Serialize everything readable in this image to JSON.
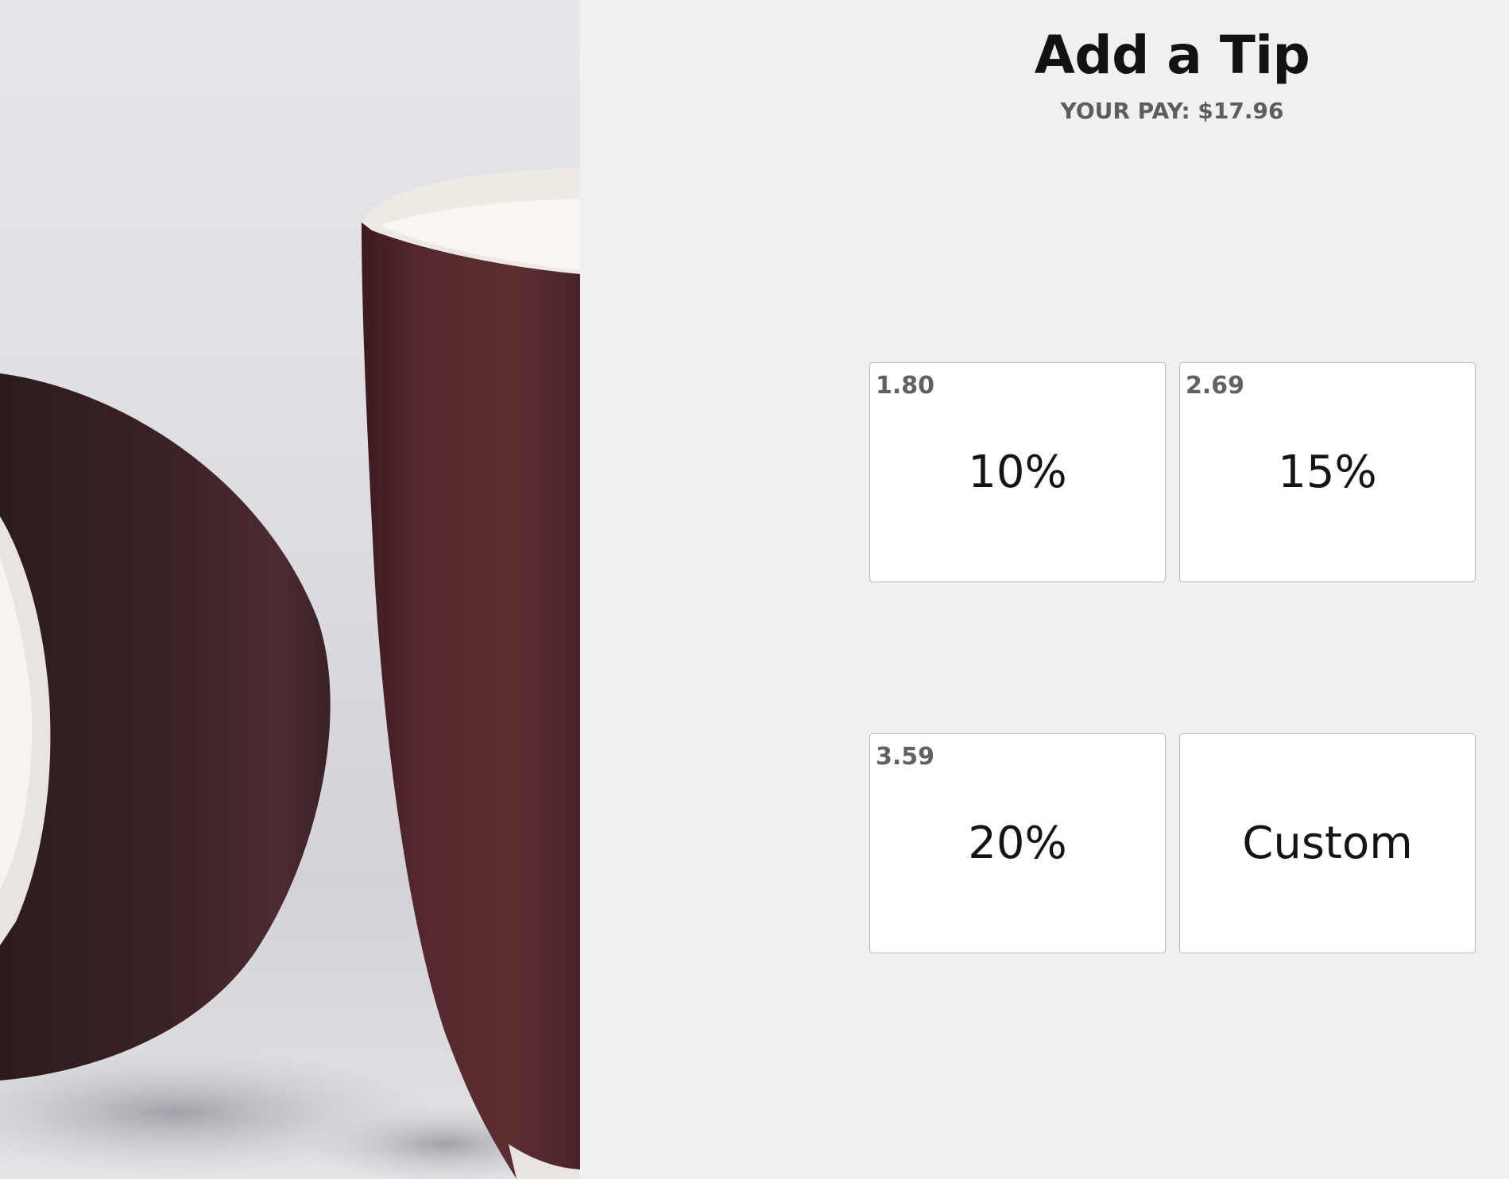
{
  "header": {
    "title": "Add a Tip",
    "subtitle": "YOUR PAY: $17.96"
  },
  "tips": [
    {
      "amount": "1.80",
      "label": "10%"
    },
    {
      "amount": "2.69",
      "label": "15%"
    },
    {
      "amount": "3.59",
      "label": "20%"
    },
    {
      "amount": "",
      "label": "Custom"
    }
  ],
  "photo": {
    "subject": "coffee-mugs-image"
  },
  "colors": {
    "panel_bg": "#f0f0f0",
    "button_bg": "#ffffff",
    "button_border": "#b9b9b9",
    "mug_color": "#4a2226"
  }
}
